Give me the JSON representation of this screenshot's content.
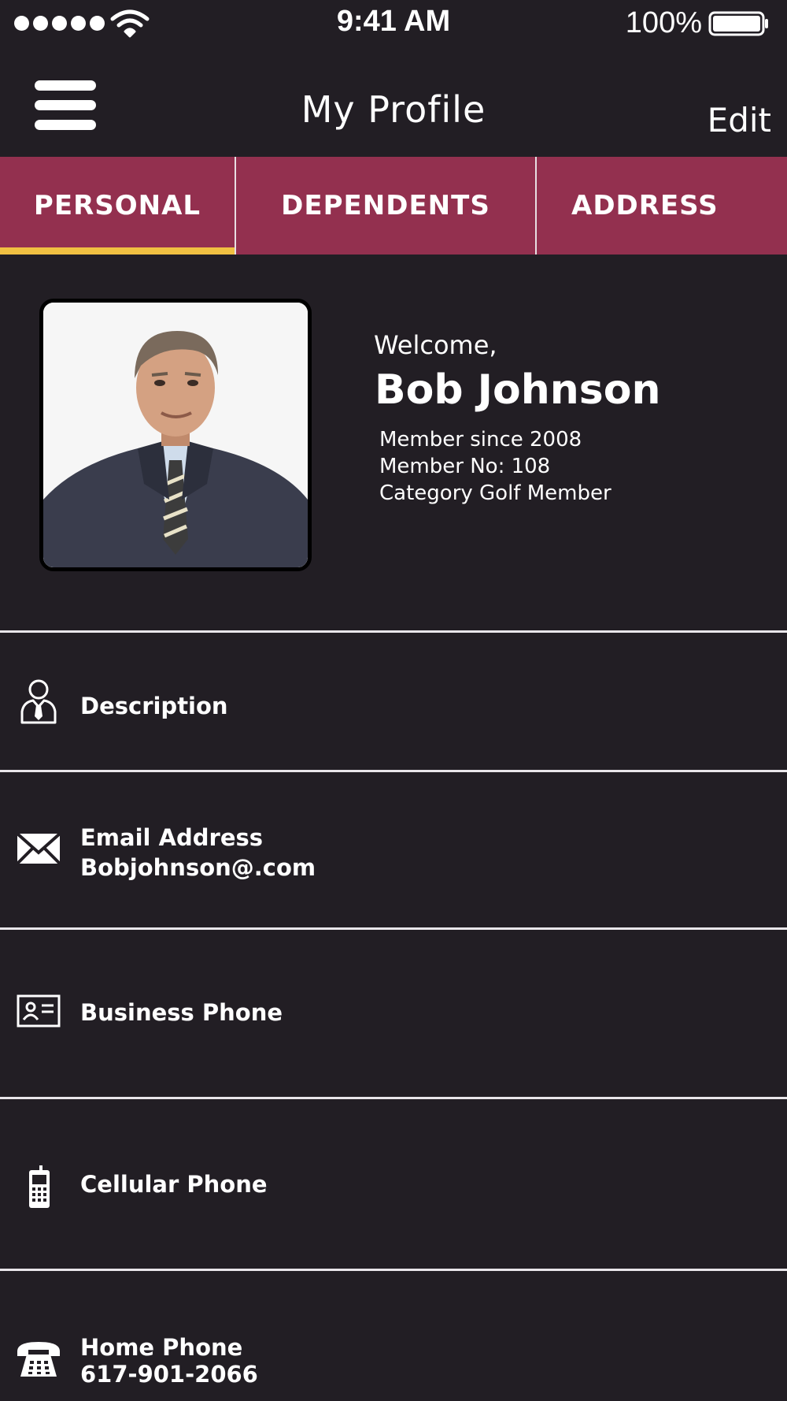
{
  "status_bar": {
    "time": "9:41 AM",
    "battery": "100%"
  },
  "nav": {
    "title": "My Profile",
    "edit_label": "Edit"
  },
  "tabs": [
    {
      "label": "PERSONAL",
      "active": true
    },
    {
      "label": "DEPENDENTS",
      "active": false
    },
    {
      "label": "ADDRESS",
      "active": false
    }
  ],
  "profile": {
    "welcome": "Welcome,",
    "name": "Bob Johnson",
    "member_since": "Member since 2008",
    "member_no": "Member No: 108",
    "category": "Category Golf Member"
  },
  "fields": [
    {
      "icon": "person-tie-icon",
      "label": "Description",
      "value": ""
    },
    {
      "icon": "envelope-icon",
      "label": "Email Address",
      "value": "Bobjohnson@.com"
    },
    {
      "icon": "id-card-icon",
      "label": "Business Phone",
      "value": ""
    },
    {
      "icon": "mobile-phone-icon",
      "label": "Cellular Phone",
      "value": ""
    },
    {
      "icon": "telephone-icon",
      "label": "Home Phone",
      "value": "617-901-2066"
    }
  ],
  "colors": {
    "background": "#221e24",
    "tab_bar": "#93304f",
    "active_tab_underline": "#f0c042"
  }
}
